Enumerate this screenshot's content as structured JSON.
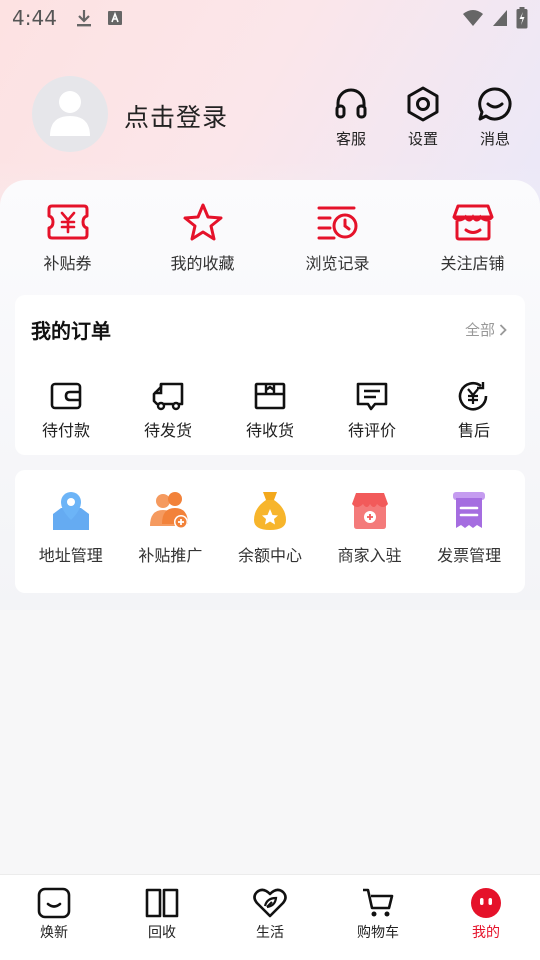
{
  "status_bar": {
    "time": "4:44"
  },
  "header": {
    "login_text": "点击登录",
    "actions": [
      {
        "label": "客服",
        "icon": "headset-icon"
      },
      {
        "label": "设置",
        "icon": "settings-icon"
      },
      {
        "label": "消息",
        "icon": "message-icon"
      }
    ]
  },
  "quick_links": [
    {
      "label": "补贴券",
      "icon": "coupon-icon"
    },
    {
      "label": "我的收藏",
      "icon": "star-icon"
    },
    {
      "label": "浏览记录",
      "icon": "history-icon"
    },
    {
      "label": "关注店铺",
      "icon": "store-icon"
    }
  ],
  "orders": {
    "title": "我的订单",
    "all_label": "全部",
    "items": [
      {
        "label": "待付款",
        "icon": "wallet-icon"
      },
      {
        "label": "待发货",
        "icon": "truck-icon"
      },
      {
        "label": "待收货",
        "icon": "package-icon"
      },
      {
        "label": "待评价",
        "icon": "comment-icon"
      },
      {
        "label": "售后",
        "icon": "refund-icon"
      }
    ]
  },
  "tools": [
    {
      "label": "地址管理",
      "icon": "map-pin-icon"
    },
    {
      "label": "补贴推广",
      "icon": "users-add-icon"
    },
    {
      "label": "余额中心",
      "icon": "money-bag-icon"
    },
    {
      "label": "商家入驻",
      "icon": "shop-icon"
    },
    {
      "label": "发票管理",
      "icon": "invoice-icon"
    }
  ],
  "bottom_nav": [
    {
      "label": "焕新",
      "icon": "smile-box-icon"
    },
    {
      "label": "回收",
      "icon": "book-icon"
    },
    {
      "label": "生活",
      "icon": "heart-leaf-icon"
    },
    {
      "label": "购物车",
      "icon": "cart-icon"
    },
    {
      "label": "我的",
      "icon": "me-face-icon"
    }
  ],
  "colors": {
    "accent_red": "#e5122a",
    "tool_blue": "#4a9cf0",
    "tool_orange": "#f2823a",
    "tool_gold": "#f3a81c",
    "tool_pink": "#f25a5a",
    "tool_purple": "#a56de0"
  }
}
